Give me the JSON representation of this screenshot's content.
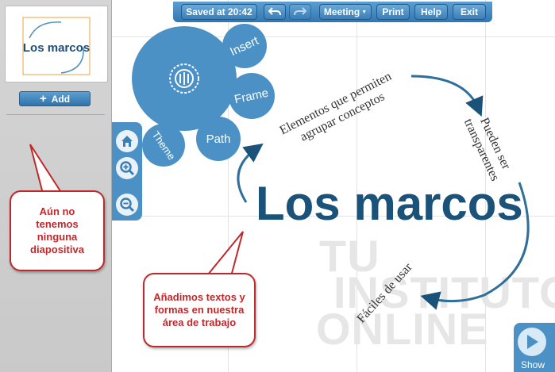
{
  "thumbnail": {
    "title": "Los marcos"
  },
  "sidebar": {
    "add_label": "Add"
  },
  "callouts": {
    "no_slides": "Aún no tenemos ninguna diapositiva",
    "add_texts": "Añadimos textos y formas en nuestra área de trabajo"
  },
  "toolbar": {
    "saved": "Saved at 20:42",
    "meeting": "Meeting",
    "print": "Print",
    "help": "Help",
    "exit": "Exit"
  },
  "menu": {
    "insert": "Insert",
    "frame": "Frame",
    "path": "Path",
    "theme": "Theme"
  },
  "canvas": {
    "title": "Los marcos",
    "text_1": "Elementos que permiten agrupar conceptos",
    "text_2": "Pueden ser transparentes",
    "text_3": "Fáciles de usar"
  },
  "watermark": {
    "line1": "TU",
    "line2": "INSTITUTO",
    "line3": "ONLINE"
  },
  "show": {
    "label": "Show"
  },
  "colors": {
    "accent": "#4b91c6",
    "title": "#1b5279",
    "callout": "#c0282c"
  }
}
